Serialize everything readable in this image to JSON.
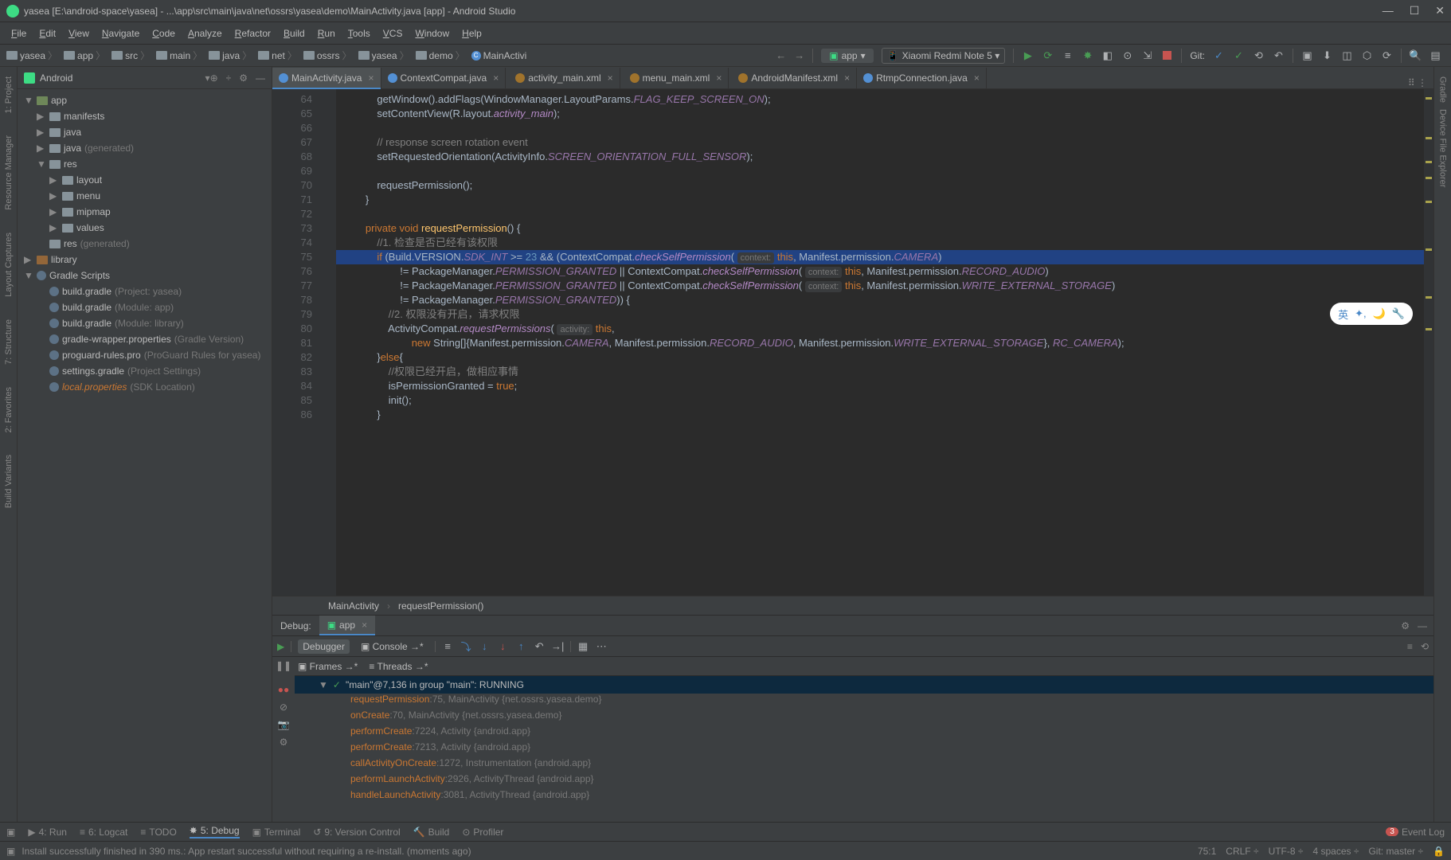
{
  "window": {
    "title": "yasea [E:\\android-space\\yasea] - ...\\app\\src\\main\\java\\net\\ossrs\\yasea\\demo\\MainActivity.java [app] - Android Studio"
  },
  "menus": [
    "File",
    "Edit",
    "View",
    "Navigate",
    "Code",
    "Analyze",
    "Refactor",
    "Build",
    "Run",
    "Tools",
    "VCS",
    "Window",
    "Help"
  ],
  "breadcrumbs": [
    "yasea",
    "app",
    "src",
    "main",
    "java",
    "net",
    "ossrs",
    "yasea",
    "demo",
    "MainActivi"
  ],
  "runConfig": {
    "name": "app",
    "device": "Xiaomi Redmi Note 5 ▾",
    "gitLabel": "Git:"
  },
  "project": {
    "scope": "Android",
    "tree": [
      {
        "lvl": 0,
        "arrow": "▼",
        "icon": "pkg",
        "label": "app"
      },
      {
        "lvl": 1,
        "arrow": "▶",
        "icon": "folder",
        "label": "manifests"
      },
      {
        "lvl": 1,
        "arrow": "▶",
        "icon": "folder",
        "label": "java"
      },
      {
        "lvl": 1,
        "arrow": "▶",
        "icon": "folder",
        "label": "java",
        "dim": " (generated)"
      },
      {
        "lvl": 1,
        "arrow": "▼",
        "icon": "folder",
        "label": "res"
      },
      {
        "lvl": 2,
        "arrow": "▶",
        "icon": "folder",
        "label": "layout"
      },
      {
        "lvl": 2,
        "arrow": "▶",
        "icon": "folder",
        "label": "menu"
      },
      {
        "lvl": 2,
        "arrow": "▶",
        "icon": "folder",
        "label": "mipmap"
      },
      {
        "lvl": 2,
        "arrow": "▶",
        "icon": "folder",
        "label": "values"
      },
      {
        "lvl": 1,
        "arrow": "",
        "icon": "folder",
        "label": "res",
        "dim": " (generated)"
      },
      {
        "lvl": 0,
        "arrow": "▶",
        "icon": "lib",
        "label": "library"
      },
      {
        "lvl": 0,
        "arrow": "▼",
        "icon": "grad",
        "label": "Gradle Scripts"
      },
      {
        "lvl": 1,
        "arrow": "",
        "icon": "grad",
        "label": "build.gradle",
        "dim": " (Project: yasea)"
      },
      {
        "lvl": 1,
        "arrow": "",
        "icon": "grad",
        "label": "build.gradle",
        "dim": " (Module: app)"
      },
      {
        "lvl": 1,
        "arrow": "",
        "icon": "grad",
        "label": "build.gradle",
        "dim": " (Module: library)"
      },
      {
        "lvl": 1,
        "arrow": "",
        "icon": "grad",
        "label": "gradle-wrapper.properties",
        "dim": " (Gradle Version)"
      },
      {
        "lvl": 1,
        "arrow": "",
        "icon": "grad",
        "label": "proguard-rules.pro",
        "dim": " (ProGuard Rules for yasea)"
      },
      {
        "lvl": 1,
        "arrow": "",
        "icon": "grad",
        "label": "settings.gradle",
        "dim": " (Project Settings)"
      },
      {
        "lvl": 1,
        "arrow": "",
        "icon": "grad",
        "label": "local.properties",
        "dim": " (SDK Location)",
        "orange": true
      }
    ]
  },
  "tabs": [
    {
      "icon": "j",
      "label": "MainActivity.java",
      "active": true,
      "close": true
    },
    {
      "icon": "j",
      "label": "ContextCompat.java",
      "close": true
    },
    {
      "icon": "x",
      "label": "activity_main.xml",
      "close": true
    },
    {
      "icon": "x",
      "label": "menu_main.xml",
      "close": true
    },
    {
      "icon": "x",
      "label": "AndroidManifest.xml",
      "close": true
    },
    {
      "icon": "j",
      "label": "RtmpConnection.java",
      "close": true
    }
  ],
  "editor": {
    "first_line": 64,
    "highlighted_line": 75,
    "lines": [
      "            getWindow().addFlags(WindowManager.LayoutParams.<const>FLAG_KEEP_SCREEN_ON</const>);",
      "            setContentView(R.layout.<it>activity_main</it>);",
      "",
      "            <cmt>// response screen rotation event</cmt>",
      "            setRequestedOrientation(ActivityInfo.<const>SCREEN_ORIENTATION_FULL_SENSOR</const>);",
      "",
      "            requestPermission();",
      "        }",
      "",
      "        <kw>private void</kw> <fn>requestPermission</fn>() {",
      "            <cmt>//1. 检查是否已经有该权限</cmt>",
      "            <kw>if</kw> (Build.VERSION.<const>SDK_INT</const> >= <num>23</num> && (ContextCompat.<it>checkSelfPermission</it>( <hint>context:</hint> <kw>this</kw>, Manifest.permission.<const>CAMERA</const>)",
      "                    != PackageManager.<const>PERMISSION_GRANTED</const> || ContextCompat.<it>checkSelfPermission</it>( <hint>context:</hint> <kw>this</kw>, Manifest.permission.<const>RECORD_AUDIO</const>)",
      "                    != PackageManager.<const>PERMISSION_GRANTED</const> || ContextCompat.<it>checkSelfPermission</it>( <hint>context:</hint> <kw>this</kw>, Manifest.permission.<const>WRITE_EXTERNAL_STORAGE</const>)",
      "                    != PackageManager.<const>PERMISSION_GRANTED</const>)) {",
      "                <cmt>//2. 权限没有开启，请求权限</cmt>",
      "                ActivityCompat.<it>requestPermissions</it>( <hint>activity:</hint> <kw>this</kw>,",
      "                        <kw>new</kw> String[]{Manifest.permission.<const>CAMERA</const>, Manifest.permission.<const>RECORD_AUDIO</const>, Manifest.permission.<const>WRITE_EXTERNAL_STORAGE</const>}, <const>RC_CAMERA</const>);",
      "            }<kw>else</kw>{",
      "                <cmt>//权限已经开启，做相应事情</cmt>",
      "                isPermissionGranted = <kw>true</kw>;",
      "                init();",
      "            }"
    ],
    "crumbs": [
      "MainActivity",
      "requestPermission()"
    ]
  },
  "ime": {
    "label": "英"
  },
  "debug": {
    "title": "Debug:",
    "app": "app",
    "subtabs": [
      "Debugger",
      "Console"
    ],
    "framesLabel": "Frames",
    "threadsLabel": "Threads",
    "thread": "\"main\"@7,136 in group \"main\": RUNNING",
    "stack": [
      {
        "m": "requestPermission",
        "loc": ":75, MainActivity {net.ossrs.yasea.demo}"
      },
      {
        "m": "onCreate",
        "loc": ":70, MainActivity {net.ossrs.yasea.demo}"
      },
      {
        "m": "performCreate",
        "loc": ":7224, Activity {android.app}"
      },
      {
        "m": "performCreate",
        "loc": ":7213, Activity {android.app}"
      },
      {
        "m": "callActivityOnCreate",
        "loc": ":1272, Instrumentation {android.app}"
      },
      {
        "m": "performLaunchActivity",
        "loc": ":2926, ActivityThread {android.app}"
      },
      {
        "m": "handleLaunchActivity",
        "loc": ":3081, ActivityThread {android.app}"
      }
    ]
  },
  "bottomTools": [
    {
      "k": "▶",
      "l": "4: Run"
    },
    {
      "k": "≡",
      "l": "6: Logcat"
    },
    {
      "k": "≡",
      "l": "TODO"
    },
    {
      "k": "✸",
      "l": "5: Debug",
      "act": true
    },
    {
      "k": "▣",
      "l": "Terminal"
    },
    {
      "k": "↺",
      "l": "9: Version Control"
    },
    {
      "k": "🔨",
      "l": "Build"
    },
    {
      "k": "⊙",
      "l": "Profiler"
    }
  ],
  "eventLog": {
    "count": "3",
    "label": "Event Log"
  },
  "status": {
    "msg": "Install successfully finished in 390 ms.: App restart successful without requiring a re-install. (moments ago)",
    "pos": "75:1",
    "le": "CRLF",
    "enc": "UTF-8",
    "indent": "4 spaces",
    "git": "Git: master"
  },
  "leftTools": [
    "1: Project",
    "Resource Manager",
    "Layout Captures",
    "7: Structure",
    "2: Favorites",
    "Build Variants"
  ],
  "rightTools": [
    "Gradle",
    "Device File Explorer"
  ]
}
